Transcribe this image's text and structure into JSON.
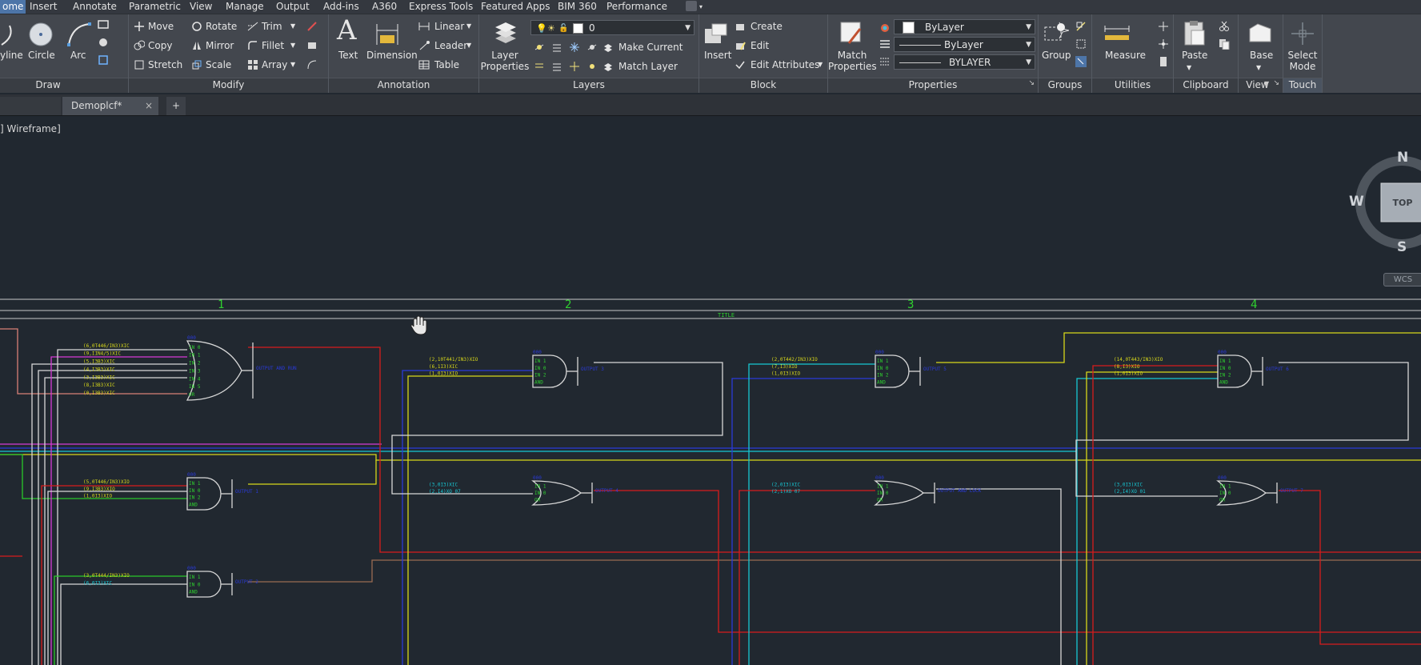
{
  "menu": {
    "tabs": [
      "ome",
      "Insert",
      "Annotate",
      "Parametric",
      "View",
      "Manage",
      "Output",
      "Add-ins",
      "A360",
      "Express Tools",
      "Featured Apps",
      "BIM 360",
      "Performance"
    ]
  },
  "ribbon": {
    "draw": {
      "title": "Draw",
      "polyline": "yline",
      "circle": "Circle",
      "arc": "Arc"
    },
    "modify": {
      "title": "Modify",
      "move": "Move",
      "rotate": "Rotate",
      "trim": "Trim",
      "copy": "Copy",
      "mirror": "Mirror",
      "fillet": "Fillet",
      "stretch": "Stretch",
      "scale": "Scale",
      "array": "Array"
    },
    "annotation": {
      "title": "Annotation",
      "text": "Text",
      "dimension": "Dimension",
      "linear": "Linear",
      "leader": "Leader",
      "table": "Table"
    },
    "layers": {
      "title": "Layers",
      "layer_properties_1": "Layer",
      "layer_properties_2": "Properties",
      "layer_value": "0",
      "make_current": "Make Current",
      "match_layer": "Match Layer"
    },
    "block": {
      "title": "Block",
      "insert": "Insert",
      "create": "Create",
      "edit": "Edit",
      "edit_attributes": "Edit Attributes"
    },
    "properties": {
      "title": "Properties",
      "match_1": "Match",
      "match_2": "Properties",
      "color": "ByLayer",
      "linetype": "ByLayer",
      "lineweight": "BYLAYER"
    },
    "groups": {
      "title": "Groups",
      "group": "Group"
    },
    "utilities": {
      "title": "Utilities",
      "measure": "Measure"
    },
    "clipboard": {
      "title": "Clipboard",
      "paste": "Paste"
    },
    "view": {
      "title": "View",
      "base": "Base"
    },
    "touch": {
      "title": "Touch",
      "select_1": "Select",
      "select_2": "Mode"
    }
  },
  "tabs": {
    "document": "Demoplcf*",
    "close": "×",
    "new": "+"
  },
  "viewport": {
    "label": "] Wireframe]"
  },
  "viewcube": {
    "n": "N",
    "s": "S",
    "w": "W",
    "face": "TOP",
    "wcs": "WCS"
  },
  "drawing": {
    "columns": [
      "1",
      "2",
      "3",
      "4"
    ],
    "title_text": "TITLE",
    "gates": [
      {
        "inputs": [
          "(6,0T446/IN3)XIC",
          "(9,IIN4/5)XIC",
          "(5,I3B3)XIC",
          "(4,I3B3)XIC",
          "(3,I3B3)XIC",
          "(8,I3B3)XIC",
          "(0,I3B3)XIC"
        ],
        "pins": [
          "IN 0",
          "IN 1",
          "IN 2",
          "IN 3",
          "IN 4",
          "IN 5",
          "OR"
        ],
        "output": "OUTPUT AND RUN"
      },
      {
        "inputs": [
          "(5,0T446/IN3)XIO",
          "(9,I3B3)XIO",
          "(1,0I3)XIO"
        ],
        "pins": [
          "IN 1",
          "IN 0",
          "IN 2",
          "AND"
        ],
        "output": "OUTPUT 1"
      },
      {
        "inputs": [
          "(3,0T444/IN3)XIO",
          "(6,0I3)XIC"
        ],
        "pins": [
          "IN 1",
          "IN 0",
          "AND"
        ],
        "output": "OUTPUT 2"
      },
      {
        "inputs": [
          "(2,10T441/IN3)XIO",
          "(6,1I3)XIC",
          "(1,0I3)XIO"
        ],
        "pins": [
          "IN 1",
          "IN 0",
          "IN 2",
          "AND"
        ],
        "output": "OUTPUT 3"
      },
      {
        "inputs": [
          "(3,0I3)XIC",
          "(2,I4)XO 07"
        ],
        "pins": [
          "IN 1",
          "IN 0",
          "OR"
        ],
        "output": "OUTPUT 4"
      },
      {
        "inputs": [
          "(2,0T442/IN3)XIO",
          "(7,I3)XIO",
          "(1,0I3)XIO"
        ],
        "pins": [
          "IN 1",
          "IN 0",
          "IN 2",
          "AND"
        ],
        "output": "OUTPUT 5"
      },
      {
        "inputs": [
          "(2,0I3)XIC",
          "(2,1)XO 07"
        ],
        "pins": [
          "IN 1",
          "IN 0",
          "OR"
        ],
        "output": "OUTPUT AND LOCK"
      },
      {
        "inputs": [
          "(14,0T443/IN3)XIO",
          "(8,I3)XIO",
          "(1,0I3)XIO"
        ],
        "pins": [
          "IN 1",
          "IN 0",
          "IN 2",
          "AND"
        ],
        "output": "OUTPUT 6"
      },
      {
        "inputs": [
          "(3,0I3)XIC",
          "(2,I4)XO 01"
        ],
        "pins": [
          "IN 1",
          "IN 0",
          "OR"
        ],
        "output": "OUTPUT 7"
      }
    ]
  },
  "colors": {
    "red": "#d81c1c",
    "magenta": "#d63ad6",
    "cyan": "#17c8d4",
    "yellow": "#d8d81a",
    "white": "#d8d8d8",
    "green": "#29c829",
    "blue": "#2a3ad8",
    "salmon": "#d98077",
    "brown": "#9a6b52"
  }
}
